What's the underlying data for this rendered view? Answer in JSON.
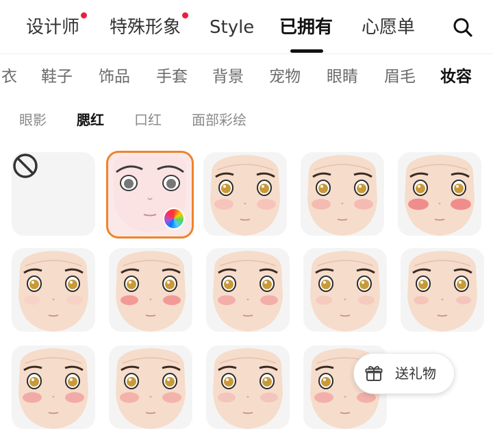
{
  "top_tabs": {
    "items": [
      {
        "label": "设计师",
        "badge": true
      },
      {
        "label": "特殊形象",
        "badge": true
      },
      {
        "label": "Style",
        "badge": false
      },
      {
        "label": "已拥有",
        "badge": false,
        "active": true
      },
      {
        "label": "心愿单",
        "badge": false
      }
    ],
    "search_icon": "search-icon"
  },
  "categories": {
    "items": [
      "衣",
      "鞋子",
      "饰品",
      "手套",
      "背景",
      "宠物",
      "眼睛",
      "眉毛",
      "妆容"
    ],
    "active": "妆容"
  },
  "subcategories": {
    "items": [
      "眼影",
      "腮红",
      "口红",
      "面部彩绘"
    ],
    "active": "腮红"
  },
  "grid": {
    "none_icon": "prohibited-icon",
    "selected_index": 1,
    "color_wheel_icon": "color-wheel-icon",
    "colors": {
      "selected_border": "#f08228",
      "badge": "#e8213a"
    }
  },
  "gift_button": {
    "label": "送礼物",
    "icon": "gift-icon"
  }
}
